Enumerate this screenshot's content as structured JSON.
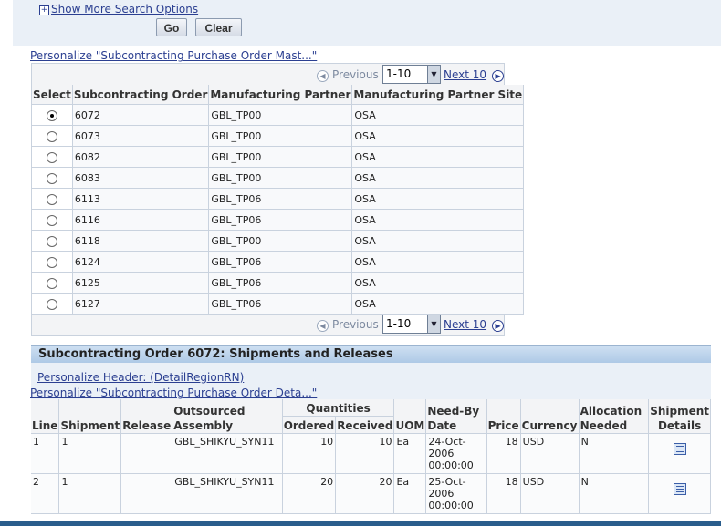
{
  "search": {
    "more_options_label": "Show More Search Options",
    "go_label": "Go",
    "clear_label": "Clear"
  },
  "results": {
    "personalize_link": "Personalize \"Subcontracting Purchase Order Mast...\"",
    "nav": {
      "previous_label": "Previous",
      "range_value": "1-10",
      "next_label": "Next 10"
    },
    "columns": [
      "Select",
      "Subcontracting Order",
      "Manufacturing Partner",
      "Manufacturing Partner Site"
    ],
    "rows": [
      {
        "order": "6072",
        "partner": "GBL_TP00",
        "site": "OSA",
        "selected": true
      },
      {
        "order": "6073",
        "partner": "GBL_TP00",
        "site": "OSA",
        "selected": false
      },
      {
        "order": "6082",
        "partner": "GBL_TP00",
        "site": "OSA",
        "selected": false
      },
      {
        "order": "6083",
        "partner": "GBL_TP00",
        "site": "OSA",
        "selected": false
      },
      {
        "order": "6113",
        "partner": "GBL_TP06",
        "site": "OSA",
        "selected": false
      },
      {
        "order": "6116",
        "partner": "GBL_TP06",
        "site": "OSA",
        "selected": false
      },
      {
        "order": "6118",
        "partner": "GBL_TP00",
        "site": "OSA",
        "selected": false
      },
      {
        "order": "6124",
        "partner": "GBL_TP06",
        "site": "OSA",
        "selected": false
      },
      {
        "order": "6125",
        "partner": "GBL_TP06",
        "site": "OSA",
        "selected": false
      },
      {
        "order": "6127",
        "partner": "GBL_TP06",
        "site": "OSA",
        "selected": false
      }
    ]
  },
  "shipments": {
    "title": "Subcontracting Order 6072: Shipments and Releases",
    "personalize_header_link": "Personalize Header: (DetailRegionRN)",
    "personalize_table_link": "Personalize \"Subcontracting Purchase Order Deta...\"",
    "columns": {
      "line": "Line",
      "shipment": "Shipment",
      "release": "Release",
      "outsourced_assembly": "Outsourced Assembly",
      "quantities": "Quantities",
      "ordered": "Ordered",
      "received": "Received",
      "uom": "UOM",
      "need_by_date": "Need-By Date",
      "price": "Price",
      "currency": "Currency",
      "allocation_needed": "Allocation Needed",
      "shipment_details": "Shipment Details"
    },
    "rows": [
      {
        "line": "1",
        "shipment": "1",
        "release": "",
        "assembly": "GBL_SHIKYU_SYN11",
        "ordered": "10",
        "received": "10",
        "uom": "Ea",
        "need_by": "24-Oct-2006 00:00:00",
        "price": "18",
        "currency": "USD",
        "allocation": "N"
      },
      {
        "line": "2",
        "shipment": "1",
        "release": "",
        "assembly": "GBL_SHIKYU_SYN11",
        "ordered": "20",
        "received": "20",
        "uom": "Ea",
        "need_by": "25-Oct-2006 00:00:00",
        "price": "18",
        "currency": "USD",
        "allocation": "N"
      }
    ]
  }
}
